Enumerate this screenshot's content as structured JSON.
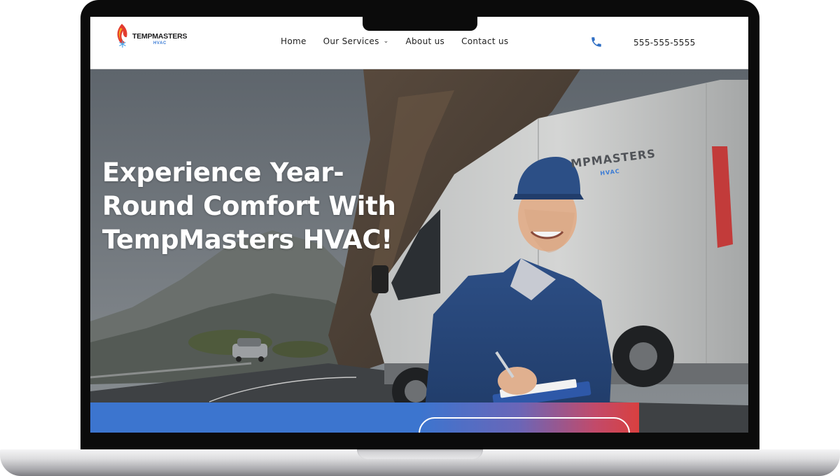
{
  "header": {
    "logo": {
      "text": "TEMPMASTERS",
      "sub": "HVAC"
    },
    "nav": [
      {
        "label": "Home",
        "has_dropdown": false
      },
      {
        "label": "Our Services",
        "has_dropdown": true
      },
      {
        "label": "About us",
        "has_dropdown": false
      },
      {
        "label": "Contact us",
        "has_dropdown": false
      }
    ],
    "phone": "555-555-5555"
  },
  "hero": {
    "title": "Experience Year-Round Comfort With TempMasters HVAC!",
    "van_logo": {
      "text": "MPMASTERS",
      "sub": "HVAC"
    }
  },
  "colors": {
    "primary_blue": "#3c75cf",
    "accent_red": "#d9403f",
    "logo_blue": "#3a7bd5"
  },
  "icons": {
    "phone": "phone-icon",
    "chevron": "chevron-down-icon",
    "logo": "flame-snowflake-icon"
  }
}
